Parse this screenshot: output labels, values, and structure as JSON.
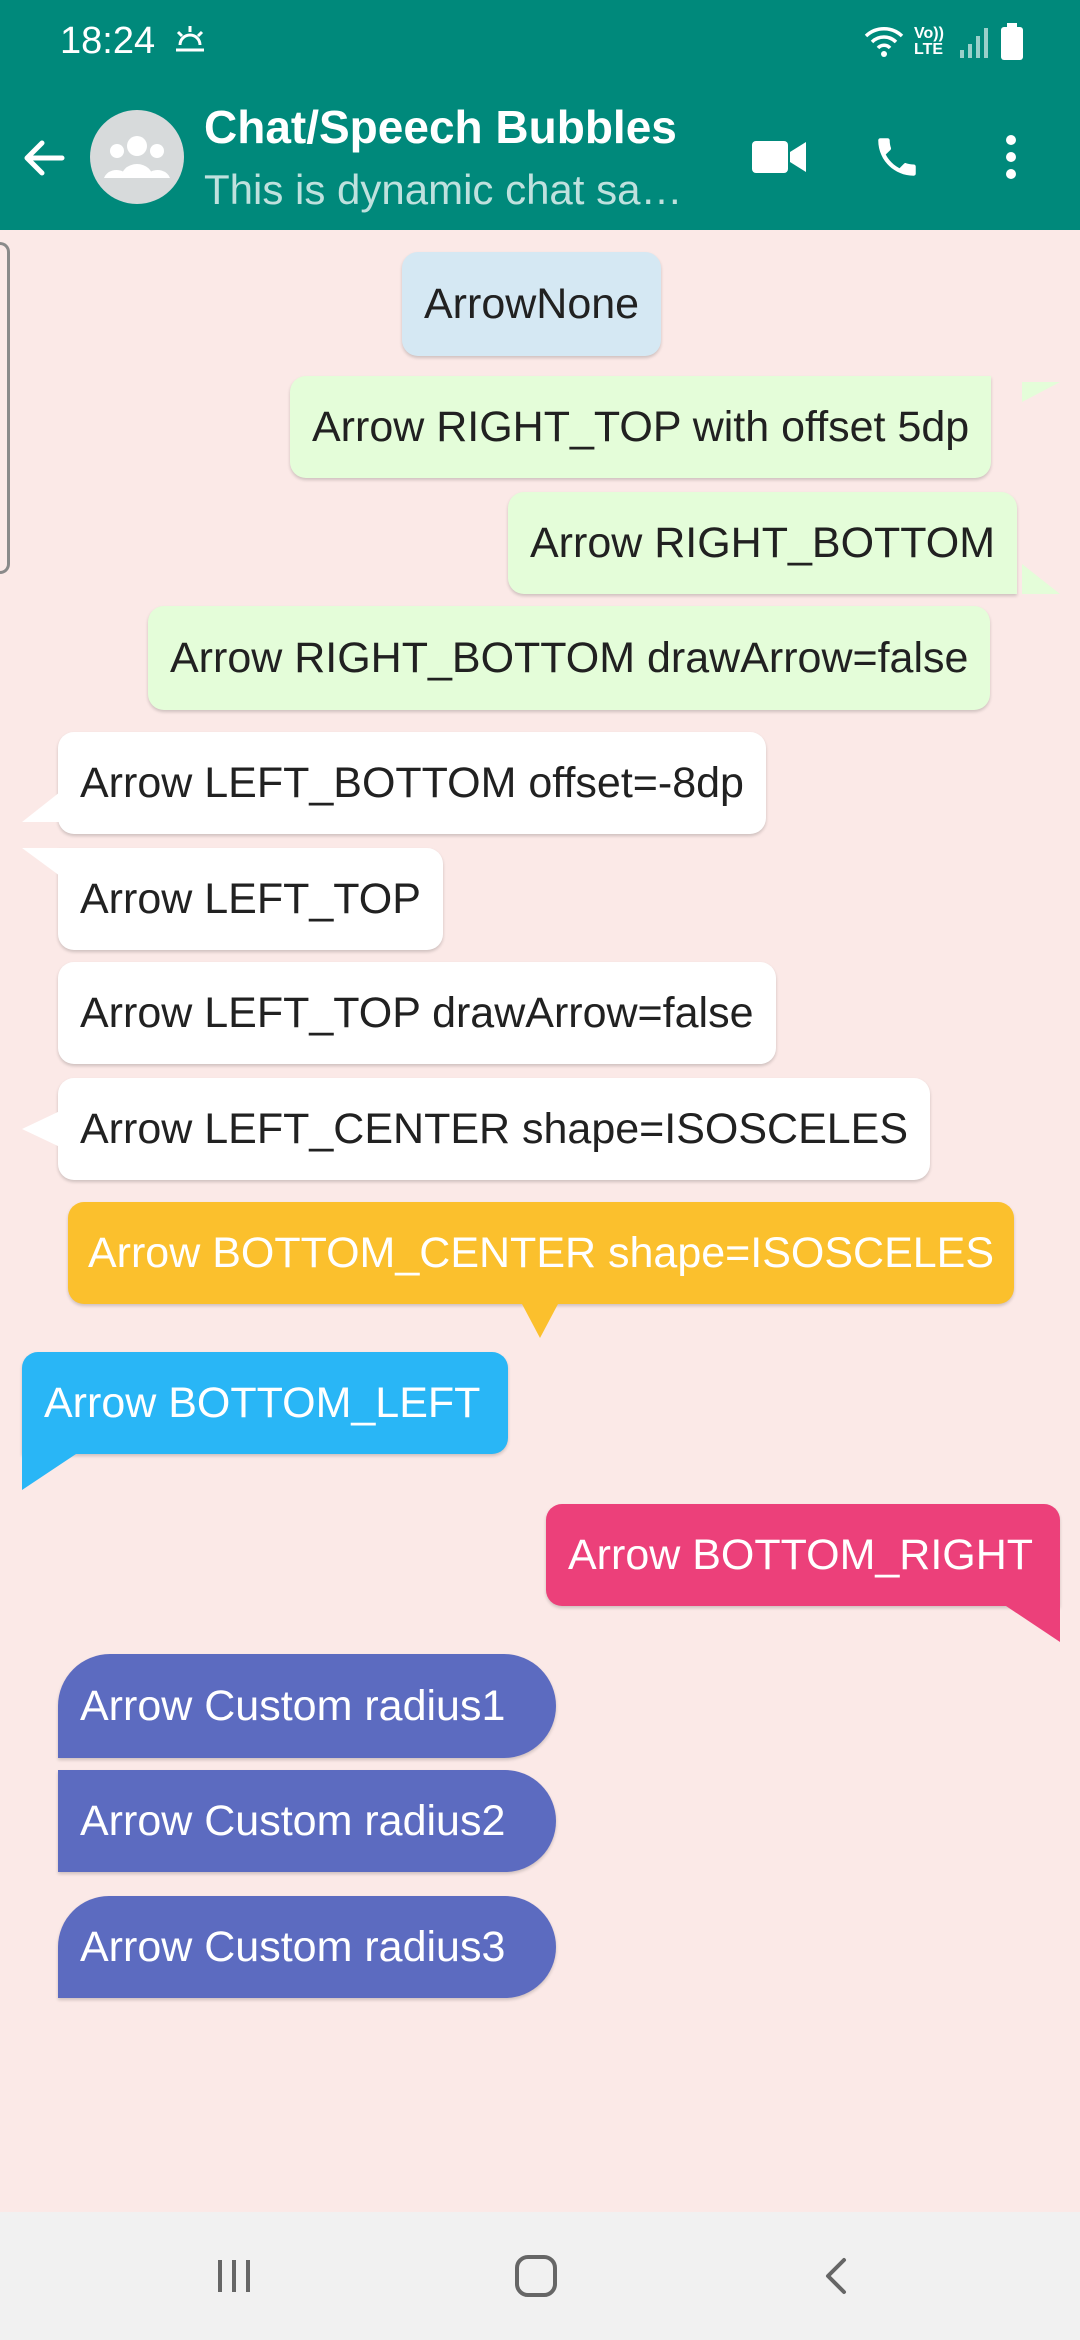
{
  "status": {
    "time": "18:24",
    "network": "Vo)) LTE"
  },
  "header": {
    "title": "Chat/Speech Bubbles",
    "subtitle": "This is dynamic chat sa…"
  },
  "messages": [
    "ArrowNone",
    "Arrow RIGHT_TOP with offset 5dp",
    "Arrow RIGHT_BOTTOM",
    "Arrow RIGHT_BOTTOM drawArrow=false",
    "Arrow LEFT_BOTTOM offset=-8dp",
    "Arrow LEFT_TOP",
    "Arrow LEFT_TOP drawArrow=false",
    "Arrow LEFT_CENTER shape=ISOSCELES",
    "Arrow BOTTOM_CENTER shape=ISOSCELES",
    "Arrow BOTTOM_LEFT",
    "Arrow BOTTOM_RIGHT",
    "Arrow Custom radius1",
    "Arrow Custom radius2",
    "Arrow Custom radius3"
  ],
  "colors": {
    "toolbar": "#00897b",
    "chat_background": "#fbe9e7",
    "bubble_none": "#d5e8f3",
    "bubble_outgoing": "#e4fdd9",
    "bubble_incoming": "#ffffff",
    "bubble_amber": "#fbc02d",
    "bubble_blue": "#29b6f6",
    "bubble_pink": "#ec407a",
    "bubble_indigo": "#5c6bc0"
  },
  "icons": {
    "back": "arrow-left-icon",
    "avatar": "group-icon",
    "video": "videocam-icon",
    "call": "phone-icon",
    "more": "more-vert-icon",
    "nav_recents": "recents-icon",
    "nav_home": "home-icon",
    "nav_back": "nav-back-icon"
  }
}
